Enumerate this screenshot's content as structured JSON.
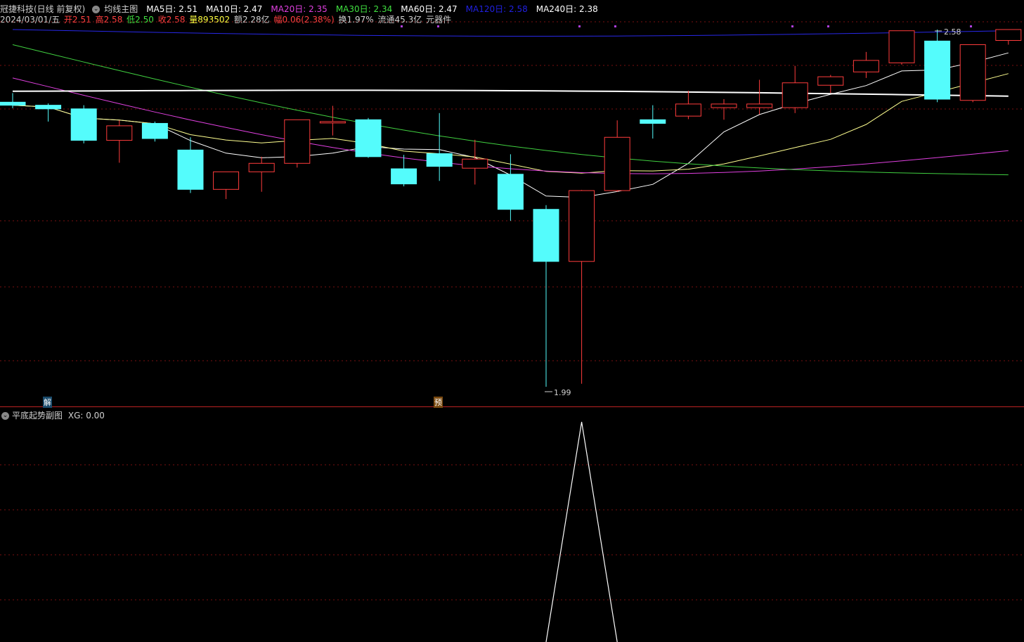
{
  "header": {
    "stock_name": "冠捷科技(日线 前复权)",
    "indicator_name": "均线主图",
    "ma_labels": [
      {
        "text": "MA5日: 2.51",
        "color": "#ffffff"
      },
      {
        "text": "MA10日: 2.47",
        "color": "#ffffff"
      },
      {
        "text": "MA20日: 2.35",
        "color": "#e040e0"
      },
      {
        "text": "MA30日: 2.34",
        "color": "#40e040"
      },
      {
        "text": "MA60日: 2.47",
        "color": "#ffffff"
      },
      {
        "text": "MA120日: 2.58",
        "color": "#2020e0"
      },
      {
        "text": "MA240日: 2.38",
        "color": "#ffffff"
      }
    ]
  },
  "quote": {
    "date": "2024/03/01/五",
    "open": "开2.51",
    "high": "高2.58",
    "low": "低2.50",
    "close": "收2.58",
    "volume": "量893502",
    "amount": "额2.28亿",
    "change": "幅0.06(2.38%)",
    "turnover": "换1.97%",
    "float": "流通45.3亿",
    "industry": "元器件"
  },
  "annotations": {
    "high_label": "2.58",
    "low_label": "1.99",
    "marker_left": "解",
    "marker_mid": "预"
  },
  "sub": {
    "title": "平底起势副图",
    "value": "XG: 0.00"
  },
  "colors": {
    "up": "#ff3c3c",
    "down": "#54fcfc",
    "ma5": "#ffffff",
    "ma10": "#ffff90",
    "ma20": "#e040e0",
    "ma30": "#40d040",
    "ma60": "#c8c8c8",
    "ma120": "#2828e8",
    "ma240": "#ffffff",
    "grid": "#7a1010"
  },
  "chart_data": {
    "type": "candlestick",
    "price_range": [
      1.99,
      2.58
    ],
    "candles": [
      {
        "o": 2.46,
        "h": 2.475,
        "l": 2.45,
        "c": 2.455
      },
      {
        "o": 2.455,
        "h": 2.458,
        "l": 2.428,
        "c": 2.449
      },
      {
        "o": 2.449,
        "h": 2.455,
        "l": 2.392,
        "c": 2.397
      },
      {
        "o": 2.397,
        "h": 2.43,
        "l": 2.36,
        "c": 2.421
      },
      {
        "o": 2.425,
        "h": 2.428,
        "l": 2.395,
        "c": 2.4
      },
      {
        "o": 2.381,
        "h": 2.402,
        "l": 2.31,
        "c": 2.316
      },
      {
        "o": 2.316,
        "h": 2.335,
        "l": 2.3,
        "c": 2.345
      },
      {
        "o": 2.345,
        "h": 2.37,
        "l": 2.312,
        "c": 2.359
      },
      {
        "o": 2.359,
        "h": 2.43,
        "l": 2.352,
        "c": 2.431
      },
      {
        "o": 2.428,
        "h": 2.454,
        "l": 2.405,
        "c": 2.428
      },
      {
        "o": 2.431,
        "h": 2.434,
        "l": 2.368,
        "c": 2.37
      },
      {
        "o": 2.35,
        "h": 2.373,
        "l": 2.321,
        "c": 2.325
      },
      {
        "o": 2.375,
        "h": 2.442,
        "l": 2.33,
        "c": 2.354
      },
      {
        "o": 2.351,
        "h": 2.398,
        "l": 2.324,
        "c": 2.366
      },
      {
        "o": 2.341,
        "h": 2.374,
        "l": 2.264,
        "c": 2.283
      },
      {
        "o": 2.283,
        "h": 2.29,
        "l": 1.99,
        "c": 2.197
      },
      {
        "o": 2.197,
        "h": 2.315,
        "l": 1.995,
        "c": 2.314
      },
      {
        "o": 2.314,
        "h": 2.43,
        "l": 2.312,
        "c": 2.402
      },
      {
        "o": 2.431,
        "h": 2.455,
        "l": 2.4,
        "c": 2.425
      },
      {
        "o": 2.437,
        "h": 2.479,
        "l": 2.432,
        "c": 2.457
      },
      {
        "o": 2.451,
        "h": 2.465,
        "l": 2.431,
        "c": 2.457
      },
      {
        "o": 2.451,
        "h": 2.497,
        "l": 2.44,
        "c": 2.457
      },
      {
        "o": 2.451,
        "h": 2.52,
        "l": 2.442,
        "c": 2.492
      },
      {
        "o": 2.488,
        "h": 2.505,
        "l": 2.475,
        "c": 2.502
      },
      {
        "o": 2.51,
        "h": 2.543,
        "l": 2.5,
        "c": 2.529
      },
      {
        "o": 2.525,
        "h": 2.565,
        "l": 2.522,
        "c": 2.578
      },
      {
        "o": 2.561,
        "h": 2.58,
        "l": 2.46,
        "c": 2.465
      },
      {
        "o": 2.463,
        "h": 2.55,
        "l": 2.46,
        "c": 2.555
      },
      {
        "o": 2.562,
        "h": 2.58,
        "l": 2.555,
        "c": 2.58
      }
    ],
    "sub_signal": {
      "peak_index": 16,
      "value": 1
    }
  }
}
